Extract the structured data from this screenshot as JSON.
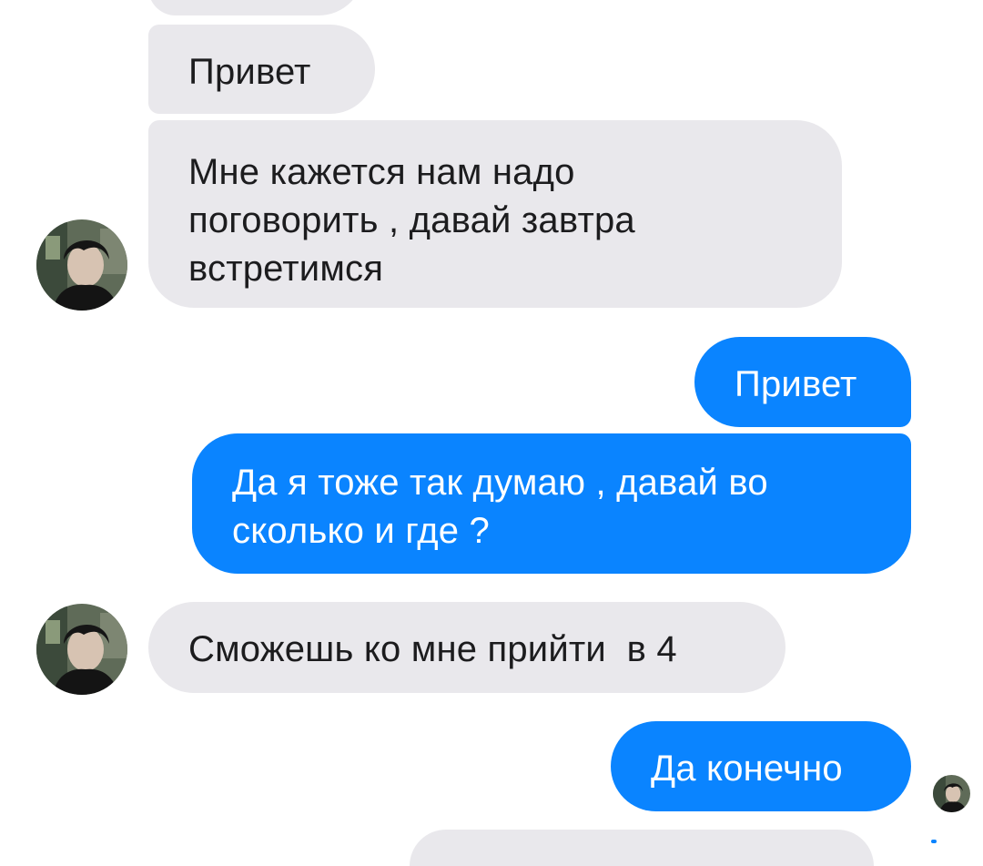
{
  "chat": {
    "messages": [
      {
        "direction": "incoming",
        "text": ""
      },
      {
        "direction": "incoming",
        "text": "Привет"
      },
      {
        "direction": "incoming",
        "text": "Мне кажется нам надо\nпоговорить , давай завтра\nвстретимся"
      },
      {
        "direction": "outgoing",
        "text": "Привет"
      },
      {
        "direction": "outgoing",
        "text": "Да я тоже так думаю , давай во\nсколько и где ?"
      },
      {
        "direction": "incoming",
        "text": "Сможешь ко мне прийти  в 4"
      },
      {
        "direction": "outgoing",
        "text": "Да конечно"
      },
      {
        "direction": "incoming",
        "text": ""
      }
    ],
    "avatars": [
      {
        "icon": "contact-avatar-icon"
      },
      {
        "icon": "contact-avatar-icon"
      },
      {
        "icon": "read-receipt-avatar-icon"
      }
    ]
  },
  "colors": {
    "incoming_bubble": "#e9e8ec",
    "incoming_text": "#1c1c1e",
    "outgoing_bubble": "#0a84ff",
    "outgoing_text": "#ffffff",
    "background": "#ffffff"
  }
}
